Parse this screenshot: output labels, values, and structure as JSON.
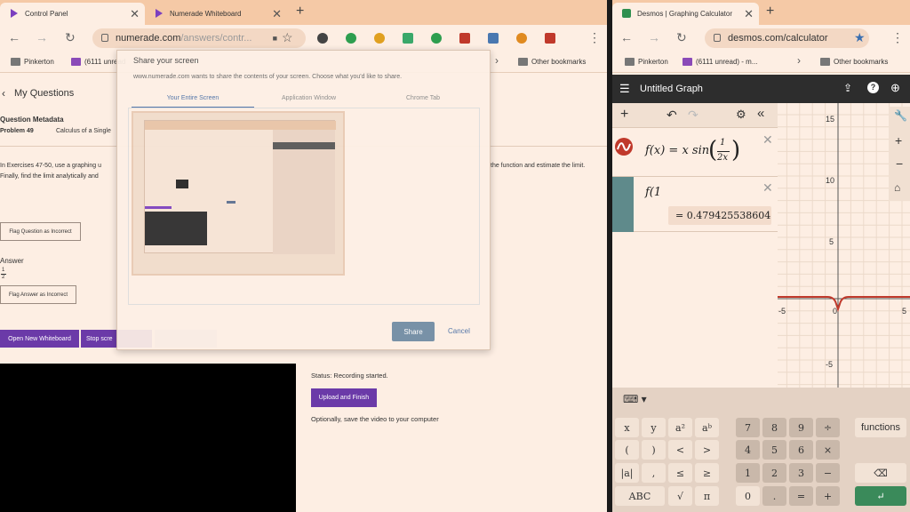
{
  "left_window": {
    "tabs": [
      {
        "label": "Control Panel",
        "active": true
      },
      {
        "label": "Numerade Whiteboard",
        "active": false
      }
    ],
    "url_main": "numerade.com",
    "url_rest": "/answers/contr...",
    "bookmarks": {
      "pinkerton": "Pinkerton",
      "mail": "(6111 unread",
      "other": "Other bookmarks"
    },
    "page": {
      "back_title": "My Questions",
      "meta_heading": "Question Metadata",
      "problem_label": "Problem 49",
      "problem_topic": "Calculus of a Single",
      "body_left": "In Exercises 47-50, use a graphing u",
      "body_left2": "Finally, find the limit analytically and",
      "body_right": "the function and estimate the limit.",
      "flag_question": "Flag Question as Incorrect",
      "answer_heading": "Answer",
      "answer_num": "1",
      "answer_den": "2",
      "flag_answer": "Flag Answer as Incorrect",
      "open_whiteboard": "Open New Whiteboard",
      "stop_screen": "Stop scre",
      "status": "Status: Recording started.",
      "upload": "Upload and Finish",
      "save_note": "Optionally, save the video to your computer"
    },
    "dialog": {
      "title": "Share your screen",
      "subtitle": "www.numerade.com wants to share the contents of your screen. Choose what you'd like to share.",
      "tabs": [
        "Your Entire Screen",
        "Application Window",
        "Chrome Tab"
      ],
      "share": "Share",
      "cancel": "Cancel"
    }
  },
  "right_window": {
    "tab_label": "Desmos | Graphing Calculator",
    "url": "desmos.com/calculator",
    "bookmarks": {
      "pinkerton": "Pinkerton",
      "mail": "(6111 unread) - m...",
      "other": "Other bookmarks"
    },
    "title": "Untitled Graph",
    "expr1": {
      "lhs": "f(x) = x sin",
      "num": "1",
      "den": "2x"
    },
    "expr2": {
      "input": "f(1",
      "result": "= 0.479425538604"
    },
    "axis": {
      "y_labels": [
        "15",
        "10",
        "5",
        "-5"
      ],
      "x_labels": [
        "-5",
        "0",
        "5"
      ]
    },
    "keyboard": {
      "row1": [
        "x",
        "y",
        "a²",
        "aᵇ",
        "7",
        "8",
        "9",
        "÷",
        "functions"
      ],
      "row2": [
        "(",
        ")",
        "<",
        ">",
        "4",
        "5",
        "6",
        "×"
      ],
      "row3": [
        "|a|",
        ",",
        "≤",
        "≥",
        "1",
        "2",
        "3",
        "−"
      ],
      "row4": [
        "ABC",
        "√",
        "π",
        "0",
        ".",
        "=",
        "+"
      ]
    }
  },
  "colors": {
    "purple": "#6b3aa8",
    "desmos_dark": "#2d2d2d",
    "curve": "#c0392b",
    "expr_tab": "#5f8a8b"
  }
}
